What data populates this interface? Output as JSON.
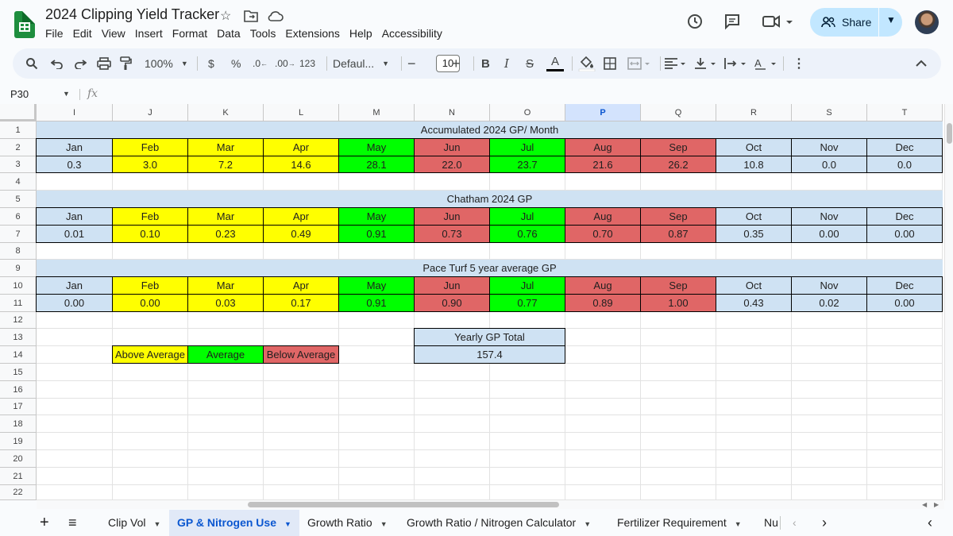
{
  "app": {
    "title": "2024 Clipping Yield Tracker",
    "menu": [
      "File",
      "Edit",
      "View",
      "Insert",
      "Format",
      "Data",
      "Tools",
      "Extensions",
      "Help",
      "Accessibility"
    ],
    "share_label": "Share"
  },
  "toolbar": {
    "zoom": "100%",
    "currency": "$",
    "percent": "%",
    "dec_decrease": ".0",
    "dec_increase": ".00",
    "number_format": "123",
    "font": "Defaul...",
    "font_size": "10"
  },
  "formula_bar": {
    "name_box": "P30",
    "fx": "fx"
  },
  "columns": [
    "I",
    "J",
    "K",
    "L",
    "M",
    "N",
    "O",
    "P",
    "Q",
    "R",
    "S",
    "T"
  ],
  "selected_column": "P",
  "rows": [
    "1",
    "2",
    "3",
    "4",
    "5",
    "6",
    "7",
    "8",
    "9",
    "10",
    "11",
    "12",
    "13",
    "14",
    "15",
    "16",
    "17",
    "18",
    "19",
    "20",
    "21",
    "22"
  ],
  "months": [
    "Jan",
    "Feb",
    "Mar",
    "Apr",
    "May",
    "Jun",
    "Jul",
    "Aug",
    "Sep",
    "Oct",
    "Nov",
    "Dec"
  ],
  "month_colors": [
    "#cfe2f3",
    "#ffff00",
    "#ffff00",
    "#ffff00",
    "#00ff00",
    "#e06666",
    "#00ff00",
    "#e06666",
    "#e06666",
    "#cfe2f3",
    "#cfe2f3",
    "#cfe2f3"
  ],
  "tables": [
    {
      "title": "Accumulated 2024 GP/ Month",
      "values": [
        "0.3",
        "3.0",
        "7.2",
        "14.6",
        "28.1",
        "22.0",
        "23.7",
        "21.6",
        "26.2",
        "10.8",
        "0.0",
        "0.0"
      ]
    },
    {
      "title": "Chatham 2024 GP",
      "values": [
        "0.01",
        "0.10",
        "0.23",
        "0.49",
        "0.91",
        "0.73",
        "0.76",
        "0.70",
        "0.87",
        "0.35",
        "0.00",
        "0.00"
      ]
    },
    {
      "title": "Pace Turf  5 year average GP",
      "values": [
        "0.00",
        "0.00",
        "0.03",
        "0.17",
        "0.91",
        "0.90",
        "0.77",
        "0.89",
        "1.00",
        "0.43",
        "0.02",
        "0.00"
      ]
    }
  ],
  "legend": [
    {
      "label": "Above Average",
      "color": "#ffff00"
    },
    {
      "label": "Average",
      "color": "#00ff00"
    },
    {
      "label": "Below Average",
      "color": "#e06666"
    }
  ],
  "yearly": {
    "label": "Yearly GP Total",
    "value": "157.4"
  },
  "sheet_tabs": [
    "Clip Vol",
    "GP & Nitrogen Use",
    "Growth Ratio",
    "Growth Ratio / Nitrogen Calculator",
    "Fertilizer Requirement",
    "Nu"
  ],
  "active_tab": "GP & Nitrogen Use"
}
